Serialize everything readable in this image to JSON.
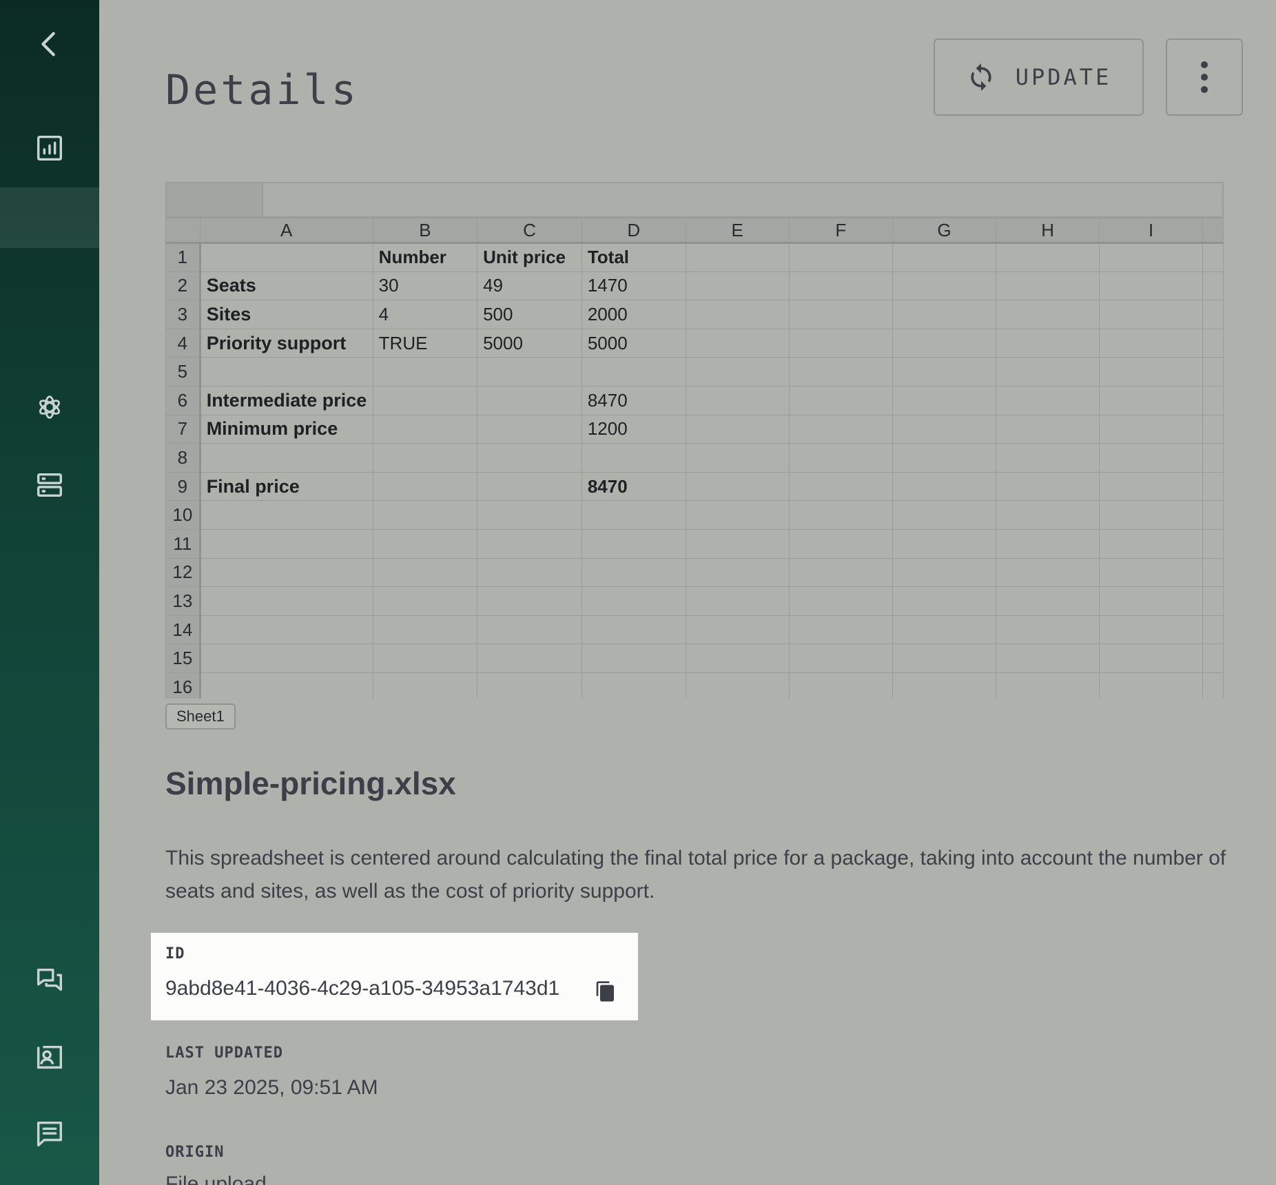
{
  "sidebar": {
    "items": [
      {
        "icon": "chevron-left-icon"
      },
      {
        "icon": "bar-chart-icon"
      },
      {
        "icon": "active-blank-item"
      },
      {
        "icon": "openai-icon"
      },
      {
        "icon": "server-icon"
      },
      {
        "icon": "chat-bubbles-icon"
      },
      {
        "icon": "contact-card-icon"
      },
      {
        "icon": "message-icon"
      }
    ]
  },
  "header": {
    "title": "Details",
    "update_label": "UPDATE"
  },
  "sheet": {
    "columns": [
      "A",
      "B",
      "C",
      "D",
      "E",
      "F",
      "G",
      "H",
      "I"
    ],
    "rows": [
      {
        "num": "1",
        "cells": [
          "",
          "Number",
          "Unit price",
          "Total",
          "",
          "",
          "",
          "",
          ""
        ]
      },
      {
        "num": "2",
        "cells": [
          "Seats",
          "30",
          "49",
          "1470",
          "",
          "",
          "",
          "",
          ""
        ]
      },
      {
        "num": "3",
        "cells": [
          "Sites",
          "4",
          "500",
          "2000",
          "",
          "",
          "",
          "",
          ""
        ]
      },
      {
        "num": "4",
        "cells": [
          "Priority support",
          "TRUE",
          "5000",
          "5000",
          "",
          "",
          "",
          "",
          ""
        ]
      },
      {
        "num": "5",
        "cells": [
          "",
          "",
          "",
          "",
          "",
          "",
          "",
          "",
          ""
        ]
      },
      {
        "num": "6",
        "cells": [
          "Intermediate price",
          "",
          "",
          "8470",
          "",
          "",
          "",
          "",
          ""
        ]
      },
      {
        "num": "7",
        "cells": [
          "Minimum price",
          "",
          "",
          "1200",
          "",
          "",
          "",
          "",
          ""
        ]
      },
      {
        "num": "8",
        "cells": [
          "",
          "",
          "",
          "",
          "",
          "",
          "",
          "",
          ""
        ]
      },
      {
        "num": "9",
        "cells": [
          "Final price",
          "",
          "",
          "8470",
          "",
          "",
          "",
          "",
          ""
        ]
      },
      {
        "num": "10",
        "cells": [
          "",
          "",
          "",
          "",
          "",
          "",
          "",
          "",
          ""
        ]
      },
      {
        "num": "11",
        "cells": [
          "",
          "",
          "",
          "",
          "",
          "",
          "",
          "",
          ""
        ]
      },
      {
        "num": "12",
        "cells": [
          "",
          "",
          "",
          "",
          "",
          "",
          "",
          "",
          ""
        ]
      },
      {
        "num": "13",
        "cells": [
          "",
          "",
          "",
          "",
          "",
          "",
          "",
          "",
          ""
        ]
      },
      {
        "num": "14",
        "cells": [
          "",
          "",
          "",
          "",
          "",
          "",
          "",
          "",
          ""
        ]
      },
      {
        "num": "15",
        "cells": [
          "",
          "",
          "",
          "",
          "",
          "",
          "",
          "",
          ""
        ]
      },
      {
        "num": "16",
        "cells": [
          "",
          "",
          "",
          "",
          "",
          "",
          "",
          "",
          ""
        ]
      }
    ],
    "tab_label": "Sheet1"
  },
  "details": {
    "file_name": "Simple-pricing.xlsx",
    "description": "This spreadsheet is centered around calculating the final total price for a package, taking into account the number of seats and sites, as well as the cost of priority support.",
    "id_label": "ID",
    "id_value": "9abd8e41-4036-4c29-a105-34953a1743d1",
    "last_updated_label": "LAST UPDATED",
    "last_updated_value": "Jan 23 2025, 09:51 AM",
    "origin_label": "ORIGIN",
    "origin_value": "File upload"
  },
  "colors": {
    "sidebar_top": "#0b2b22",
    "sidebar_bottom": "#185747",
    "page_bg": "#aeb1ac",
    "text": "#3d3f48",
    "highlight_card": "#fcfcfb"
  }
}
